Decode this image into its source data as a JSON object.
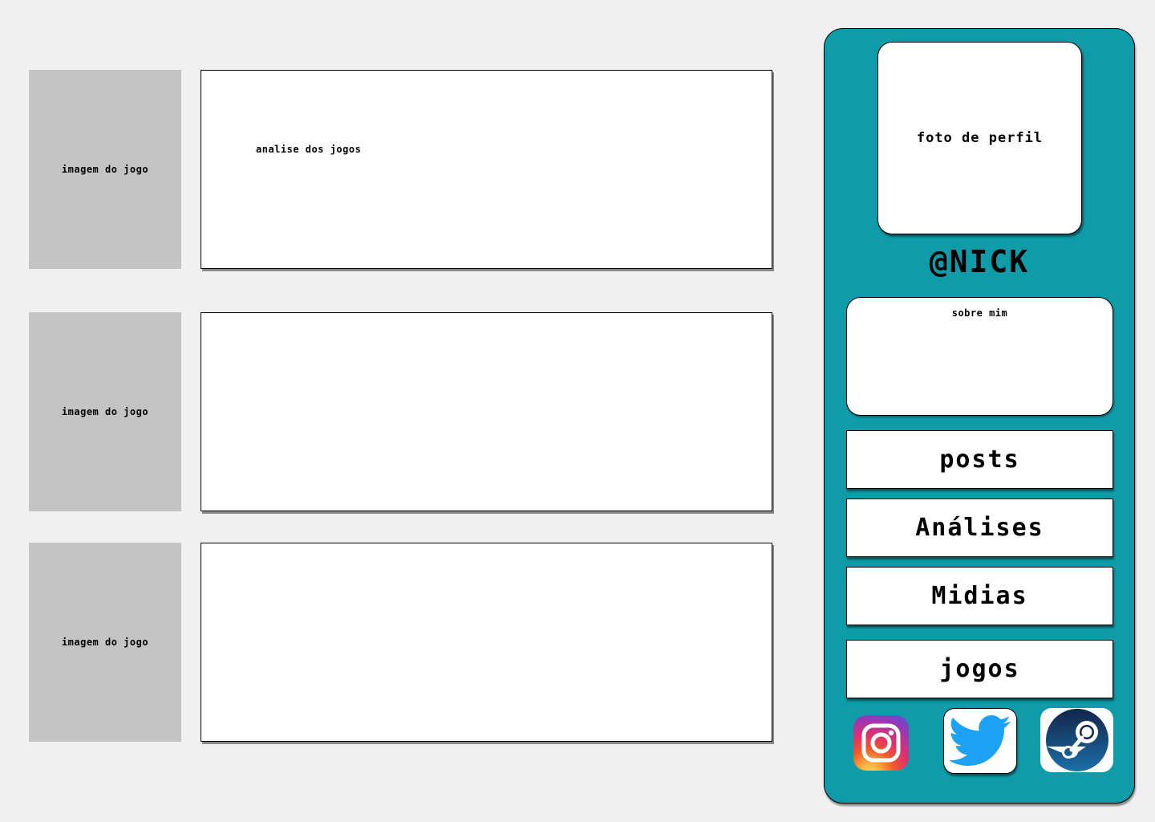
{
  "feed": {
    "posts": [
      {
        "image_label": "imagem do jogo",
        "text": "analise dos jogos"
      },
      {
        "image_label": "imagem do jogo",
        "text": ""
      },
      {
        "image_label": "imagem do jogo",
        "text": ""
      }
    ]
  },
  "sidebar": {
    "profile_photo_label": "foto de perfil",
    "nickname": "@NICK",
    "about_label": "sobre mim",
    "nav": [
      {
        "label": "posts"
      },
      {
        "label": "Análises"
      },
      {
        "label": "Midias"
      },
      {
        "label": "jogos"
      }
    ],
    "social_icons": [
      "instagram-icon",
      "twitter-icon",
      "steam-icon"
    ],
    "accent_color": "#0f9ba8"
  }
}
